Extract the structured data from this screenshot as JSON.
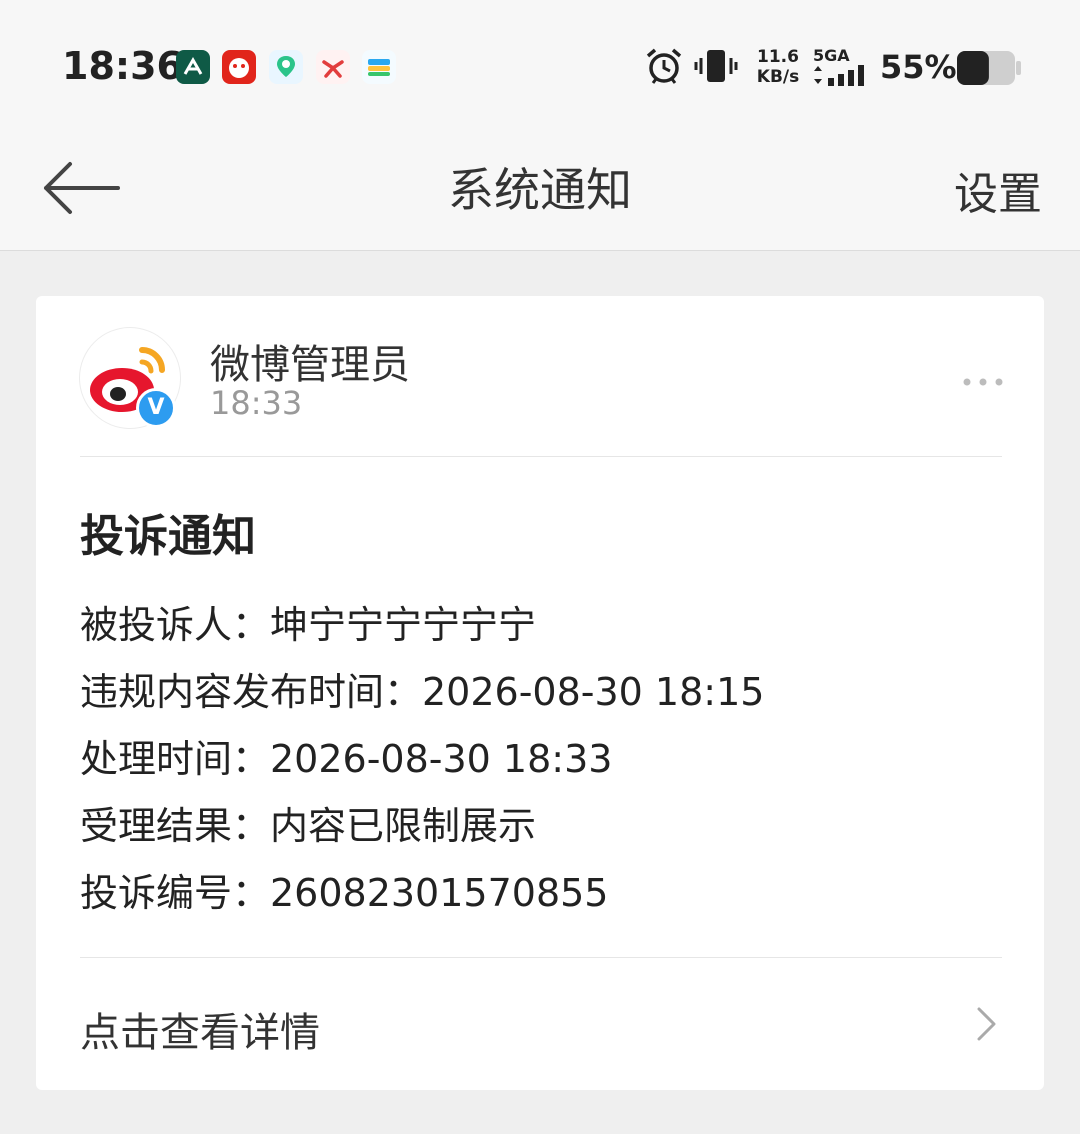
{
  "status_bar": {
    "time": "18:36",
    "app_icons": [
      "app-icon-green",
      "app-icon-jd",
      "app-icon-map",
      "app-icon-delivery",
      "app-icon-wallet"
    ],
    "net_speed_value": "11.6",
    "net_speed_unit": "KB/s",
    "signal_label": "5GA",
    "battery_percent": "55%",
    "battery_level": 0.55
  },
  "header": {
    "title": "系统通知",
    "settings_label": "设置",
    "back_icon": "arrow-left-icon"
  },
  "message": {
    "sender_name": "微博管理员",
    "sender_time": "18:33",
    "verified_mark": "V",
    "more_icon": "more-dots-icon",
    "title": "投诉通知",
    "lines": [
      "被投诉人：坤宁宁宁宁宁宁",
      "违规内容发布时间：2026-08-30 18:15",
      "处理时间：2026-08-30 18:33",
      "受理结果：内容已限制展示",
      "投诉编号：26082301570855"
    ],
    "details_label": "点击查看详情",
    "details_icon": "chevron-right-icon"
  },
  "colors": {
    "accent_blue": "#2d9cf0",
    "weibo_red": "#e6162d",
    "weibo_orange": "#f5a623"
  }
}
